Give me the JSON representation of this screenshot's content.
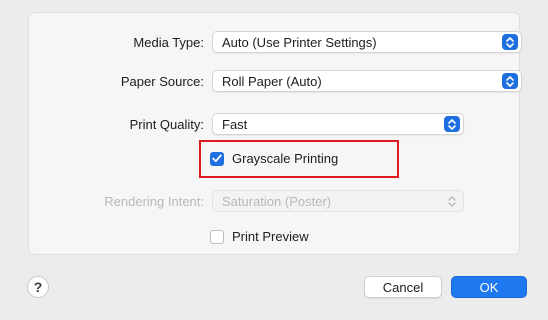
{
  "fields": {
    "media_type_label": "Media Type:",
    "media_type_value": "Auto (Use Printer Settings)",
    "paper_source_label": "Paper Source:",
    "paper_source_value": "Roll Paper (Auto)",
    "print_quality_label": "Print Quality:",
    "print_quality_value": "Fast",
    "grayscale_label": "Grayscale Printing",
    "grayscale_checked": true,
    "rendering_intent_label": "Rendering Intent:",
    "rendering_intent_value": "Saturation (Poster)",
    "print_preview_label": "Print Preview",
    "print_preview_checked": false
  },
  "buttons": {
    "help": "?",
    "cancel": "Cancel",
    "ok": "OK"
  },
  "colors": {
    "accent": "#1e6fe0",
    "highlight_border": "#e0181f"
  },
  "icons": {
    "stepper": "chevron-up-down-icon",
    "checkbox_check": "checkmark-icon"
  }
}
